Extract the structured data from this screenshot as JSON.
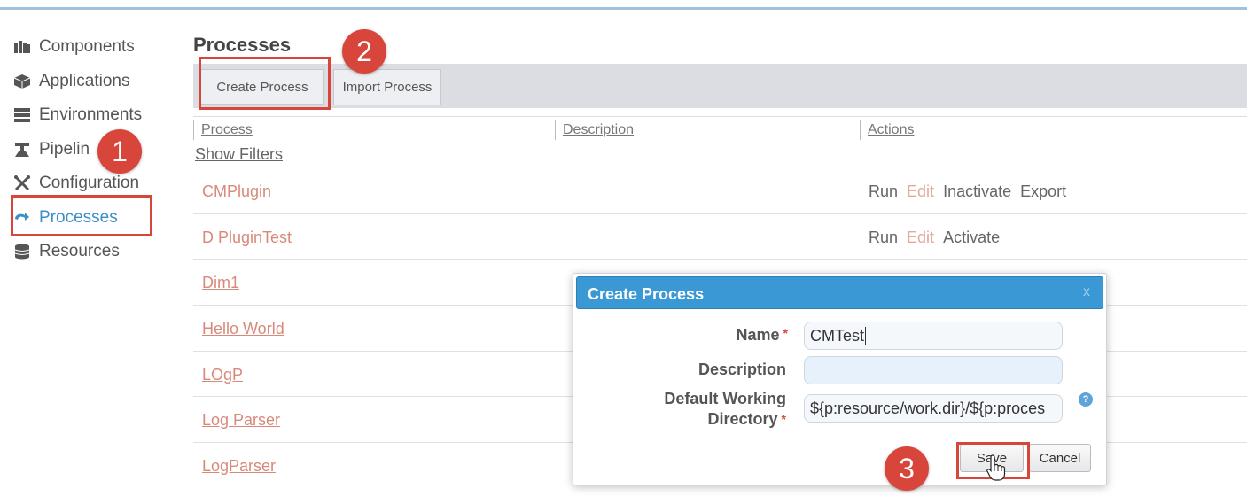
{
  "sidebar": {
    "items": [
      {
        "label": "Components",
        "icon": "components-icon"
      },
      {
        "label": "Applications",
        "icon": "applications-icon"
      },
      {
        "label": "Environments",
        "icon": "environments-icon"
      },
      {
        "label": "Pipelin",
        "icon": "pipeline-icon"
      },
      {
        "label": "Configuration",
        "icon": "configuration-icon"
      },
      {
        "label": "Processes",
        "icon": "processes-icon"
      },
      {
        "label": "Resources",
        "icon": "resources-icon"
      }
    ],
    "active_color": "#3b8fc8"
  },
  "page": {
    "title": "Processes",
    "tabs": [
      {
        "label": "Create Process"
      },
      {
        "label": "Import Process"
      }
    ],
    "columns": [
      "Process",
      "Description",
      "Actions"
    ],
    "show_filters": "Show Filters"
  },
  "processes": [
    {
      "name": "CMPlugin",
      "actions": [
        "Run",
        "Edit",
        "Inactivate",
        "Export"
      ]
    },
    {
      "name": "D PluginTest",
      "actions": [
        "Run",
        "Edit",
        "Activate"
      ]
    },
    {
      "name": "Dim1",
      "actions": []
    },
    {
      "name": "Hello World",
      "actions": []
    },
    {
      "name": "LOgP",
      "actions": []
    },
    {
      "name": "Log Parser",
      "actions": []
    },
    {
      "name": "LogParser",
      "actions": []
    }
  ],
  "dialog": {
    "title": "Create Process",
    "close": "x",
    "name_label": "Name",
    "name_value": "CMTest",
    "description_label": "Description",
    "description_value": "",
    "workdir_label_1": "Default Working",
    "workdir_label_2": "Directory",
    "workdir_value": "${p:resource/work.dir}/${p:proces",
    "required_mark": "*",
    "help": "?",
    "save_label": "Save",
    "cancel_label": "Cancel"
  },
  "annotations": {
    "step1": "1",
    "step2": "2",
    "step3": "3",
    "color": "#d8453b"
  }
}
